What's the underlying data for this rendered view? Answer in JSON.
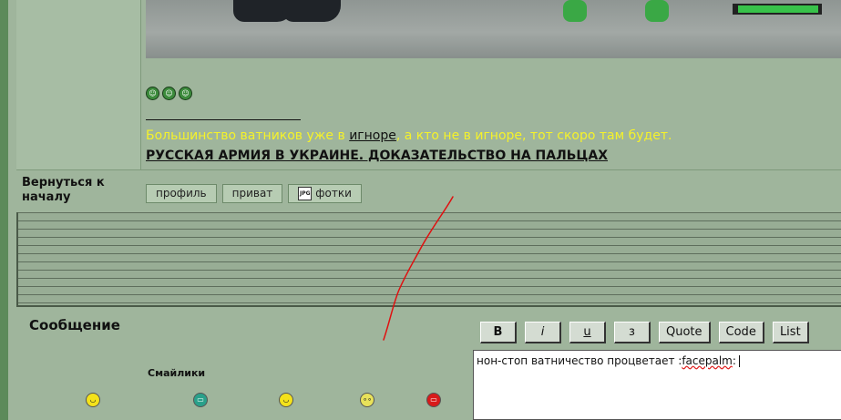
{
  "signature": {
    "text_before": "Большинство ватников уже в ",
    "ignore_link": "игноре",
    "text_after": ", а кто не в игноре, тот скоро там будет.",
    "bold_link": "РУССКАЯ АРМИЯ В УКРАИНЕ. ДОКАЗАТЕЛЬСТВО НА ПАЛЬЦАХ"
  },
  "post_footer": {
    "back_to_top": "Вернуться к началу",
    "buttons": [
      "профиль",
      "приват",
      "фотки"
    ],
    "jpg_icon_label": "JPG"
  },
  "reply": {
    "heading": "Сообщение",
    "smilies_heading": "Смайлики",
    "format_buttons": [
      "B",
      "i",
      "u",
      "з",
      "Quote",
      "Code",
      "List"
    ],
    "textarea_before": "нон-стоп ватничество процветает  :",
    "textarea_misspelled": "facepalm",
    "textarea_after": ":"
  },
  "icons": {
    "mini_smilies": [
      "green-smiley-icon",
      "green-smiley-icon",
      "green-smiley-icon"
    ],
    "smilies": [
      "smile-icon",
      "grin-icon",
      "happy-icon",
      "roll-eyes-icon",
      "angry-icon"
    ]
  },
  "colors": {
    "background": "#9fb59c",
    "signature_text": "#f5f22a",
    "annotation_red": "#e01010",
    "smiley_yellow": "#f4e21a",
    "smiley_teal": "#2aa08a",
    "smiley_red": "#d81a1a"
  }
}
